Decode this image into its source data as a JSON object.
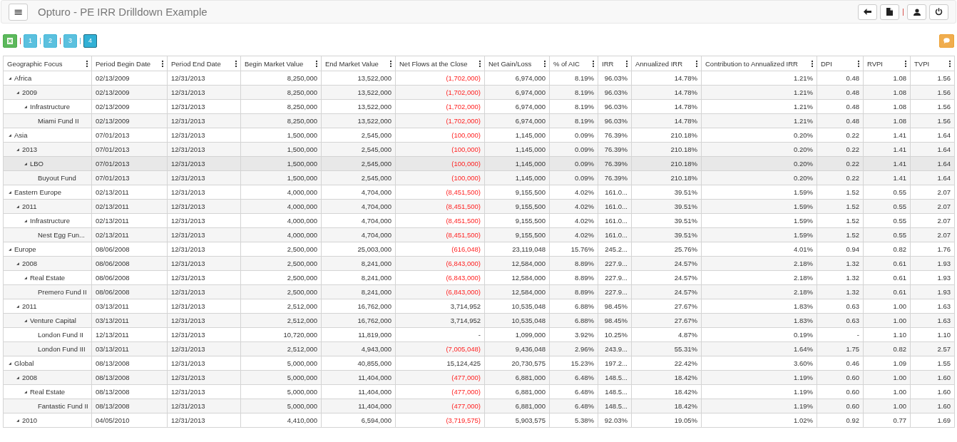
{
  "header": {
    "menu_icon": "≡",
    "title": "Opturo - PE IRR Drilldown Example"
  },
  "toolbar": {
    "levels": [
      {
        "label": "1",
        "selected": false
      },
      {
        "label": "2",
        "selected": false
      },
      {
        "label": "3",
        "selected": false
      },
      {
        "label": "4",
        "selected": true
      }
    ]
  },
  "table": {
    "tree_column": "Geographic Focus",
    "columns": [
      "Period Begin Date",
      "Period End Date",
      "Begin Market Value",
      "End Market Value",
      "Net Flows at the Close",
      "Net Gain/Loss",
      "% of AIC",
      "IRR",
      "Annualized IRR",
      "Contribution to Annualized IRR",
      "DPI",
      "RVPI",
      "TVPI"
    ],
    "rows": [
      {
        "label": "Africa",
        "expanded": true,
        "selected": false,
        "net_flows_negative": true,
        "cells": [
          "02/13/2009",
          "12/31/2013",
          "8,250,000",
          "13,522,000",
          "(1,702,000)",
          "6,974,000",
          "8.19%",
          "96.03%",
          "14.78%",
          "1.21%",
          "0.48",
          "1.08",
          "1.56"
        ],
        "children": [
          {
            "label": "2009",
            "expanded": true,
            "selected": false,
            "net_flows_negative": true,
            "cells": [
              "02/13/2009",
              "12/31/2013",
              "8,250,000",
              "13,522,000",
              "(1,702,000)",
              "6,974,000",
              "8.19%",
              "96.03%",
              "14.78%",
              "1.21%",
              "0.48",
              "1.08",
              "1.56"
            ],
            "children": [
              {
                "label": "Infrastructure",
                "expanded": true,
                "selected": false,
                "net_flows_negative": true,
                "cells": [
                  "02/13/2009",
                  "12/31/2013",
                  "8,250,000",
                  "13,522,000",
                  "(1,702,000)",
                  "6,974,000",
                  "8.19%",
                  "96.03%",
                  "14.78%",
                  "1.21%",
                  "0.48",
                  "1.08",
                  "1.56"
                ],
                "children": [
                  {
                    "label": "Miami Fund II",
                    "selected": false,
                    "net_flows_negative": true,
                    "cells": [
                      "02/13/2009",
                      "12/31/2013",
                      "8,250,000",
                      "13,522,000",
                      "(1,702,000)",
                      "6,974,000",
                      "8.19%",
                      "96.03%",
                      "14.78%",
                      "1.21%",
                      "0.48",
                      "1.08",
                      "1.56"
                    ]
                  }
                ]
              }
            ]
          }
        ]
      },
      {
        "label": "Asia",
        "expanded": true,
        "selected": false,
        "net_flows_negative": true,
        "cells": [
          "07/01/2013",
          "12/31/2013",
          "1,500,000",
          "2,545,000",
          "(100,000)",
          "1,145,000",
          "0.09%",
          "76.39%",
          "210.18%",
          "0.20%",
          "0.22",
          "1.41",
          "1.64"
        ],
        "children": [
          {
            "label": "2013",
            "expanded": true,
            "selected": false,
            "net_flows_negative": true,
            "cells": [
              "07/01/2013",
              "12/31/2013",
              "1,500,000",
              "2,545,000",
              "(100,000)",
              "1,145,000",
              "0.09%",
              "76.39%",
              "210.18%",
              "0.20%",
              "0.22",
              "1.41",
              "1.64"
            ],
            "children": [
              {
                "label": "LBO",
                "expanded": true,
                "selected": true,
                "net_flows_negative": true,
                "cells": [
                  "07/01/2013",
                  "12/31/2013",
                  "1,500,000",
                  "2,545,000",
                  "(100,000)",
                  "1,145,000",
                  "0.09%",
                  "76.39%",
                  "210.18%",
                  "0.20%",
                  "0.22",
                  "1.41",
                  "1.64"
                ],
                "children": [
                  {
                    "label": "Buyout Fund",
                    "selected": false,
                    "net_flows_negative": true,
                    "cells": [
                      "07/01/2013",
                      "12/31/2013",
                      "1,500,000",
                      "2,545,000",
                      "(100,000)",
                      "1,145,000",
                      "0.09%",
                      "76.39%",
                      "210.18%",
                      "0.20%",
                      "0.22",
                      "1.41",
                      "1.64"
                    ]
                  }
                ]
              }
            ]
          }
        ]
      },
      {
        "label": "Eastern Europe",
        "expanded": true,
        "selected": false,
        "net_flows_negative": true,
        "cells": [
          "02/13/2011",
          "12/31/2013",
          "4,000,000",
          "4,704,000",
          "(8,451,500)",
          "9,155,500",
          "4.02%",
          "161.0...",
          "39.51%",
          "1.59%",
          "1.52",
          "0.55",
          "2.07"
        ],
        "children": [
          {
            "label": "2011",
            "expanded": true,
            "selected": false,
            "net_flows_negative": true,
            "cells": [
              "02/13/2011",
              "12/31/2013",
              "4,000,000",
              "4,704,000",
              "(8,451,500)",
              "9,155,500",
              "4.02%",
              "161.0...",
              "39.51%",
              "1.59%",
              "1.52",
              "0.55",
              "2.07"
            ],
            "children": [
              {
                "label": "Infrastructure",
                "expanded": true,
                "selected": false,
                "net_flows_negative": true,
                "cells": [
                  "02/13/2011",
                  "12/31/2013",
                  "4,000,000",
                  "4,704,000",
                  "(8,451,500)",
                  "9,155,500",
                  "4.02%",
                  "161.0...",
                  "39.51%",
                  "1.59%",
                  "1.52",
                  "0.55",
                  "2.07"
                ],
                "children": [
                  {
                    "label": "Nest Egg Fun...",
                    "selected": false,
                    "net_flows_negative": true,
                    "cells": [
                      "02/13/2011",
                      "12/31/2013",
                      "4,000,000",
                      "4,704,000",
                      "(8,451,500)",
                      "9,155,500",
                      "4.02%",
                      "161.0...",
                      "39.51%",
                      "1.59%",
                      "1.52",
                      "0.55",
                      "2.07"
                    ]
                  }
                ]
              }
            ]
          }
        ]
      },
      {
        "label": "Europe",
        "expanded": true,
        "selected": false,
        "net_flows_negative": true,
        "cells": [
          "08/06/2008",
          "12/31/2013",
          "2,500,000",
          "25,003,000",
          "(616,048)",
          "23,119,048",
          "15.76%",
          "245.2...",
          "25.76%",
          "4.01%",
          "0.94",
          "0.82",
          "1.76"
        ],
        "children": [
          {
            "label": "2008",
            "expanded": true,
            "selected": false,
            "net_flows_negative": true,
            "cells": [
              "08/06/2008",
              "12/31/2013",
              "2,500,000",
              "8,241,000",
              "(6,843,000)",
              "12,584,000",
              "8.89%",
              "227.9...",
              "24.57%",
              "2.18%",
              "1.32",
              "0.61",
              "1.93"
            ],
            "children": [
              {
                "label": "Real Estate",
                "expanded": true,
                "selected": false,
                "net_flows_negative": true,
                "cells": [
                  "08/06/2008",
                  "12/31/2013",
                  "2,500,000",
                  "8,241,000",
                  "(6,843,000)",
                  "12,584,000",
                  "8.89%",
                  "227.9...",
                  "24.57%",
                  "2.18%",
                  "1.32",
                  "0.61",
                  "1.93"
                ],
                "children": [
                  {
                    "label": "Premero Fund II",
                    "selected": false,
                    "net_flows_negative": true,
                    "cells": [
                      "08/06/2008",
                      "12/31/2013",
                      "2,500,000",
                      "8,241,000",
                      "(6,843,000)",
                      "12,584,000",
                      "8.89%",
                      "227.9...",
                      "24.57%",
                      "2.18%",
                      "1.32",
                      "0.61",
                      "1.93"
                    ]
                  }
                ]
              }
            ]
          },
          {
            "label": "2011",
            "expanded": true,
            "selected": false,
            "net_flows_negative": false,
            "cells": [
              "03/13/2011",
              "12/31/2013",
              "2,512,000",
              "16,762,000",
              "3,714,952",
              "10,535,048",
              "6.88%",
              "98.45%",
              "27.67%",
              "1.83%",
              "0.63",
              "1.00",
              "1.63"
            ],
            "children": [
              {
                "label": "Venture Capital",
                "expanded": true,
                "selected": false,
                "net_flows_negative": false,
                "cells": [
                  "03/13/2011",
                  "12/31/2013",
                  "2,512,000",
                  "16,762,000",
                  "3,714,952",
                  "10,535,048",
                  "6.88%",
                  "98.45%",
                  "27.67%",
                  "1.83%",
                  "0.63",
                  "1.00",
                  "1.63"
                ],
                "children": [
                  {
                    "label": "London Fund II",
                    "selected": false,
                    "net_flows_negative": false,
                    "cells": [
                      "12/13/2011",
                      "12/31/2013",
                      "10,720,000",
                      "11,819,000",
                      "-",
                      "1,099,000",
                      "3.92%",
                      "10.25%",
                      "4.87%",
                      "0.19%",
                      "-",
                      "1.10",
                      "1.10"
                    ]
                  },
                  {
                    "label": "London Fund III",
                    "selected": false,
                    "net_flows_negative": true,
                    "cells": [
                      "03/13/2011",
                      "12/31/2013",
                      "2,512,000",
                      "4,943,000",
                      "(7,005,048)",
                      "9,436,048",
                      "2.96%",
                      "243.9...",
                      "55.31%",
                      "1.64%",
                      "1.75",
                      "0.82",
                      "2.57"
                    ]
                  }
                ]
              }
            ]
          }
        ]
      },
      {
        "label": "Global",
        "expanded": true,
        "selected": false,
        "net_flows_negative": false,
        "cells": [
          "08/13/2008",
          "12/31/2013",
          "5,000,000",
          "40,855,000",
          "15,124,425",
          "20,730,575",
          "15.23%",
          "197.2...",
          "22.42%",
          "3.60%",
          "0.46",
          "1.09",
          "1.55"
        ],
        "children": [
          {
            "label": "2008",
            "expanded": true,
            "selected": false,
            "net_flows_negative": true,
            "cells": [
              "08/13/2008",
              "12/31/2013",
              "5,000,000",
              "11,404,000",
              "(477,000)",
              "6,881,000",
              "6.48%",
              "148.5...",
              "18.42%",
              "1.19%",
              "0.60",
              "1.00",
              "1.60"
            ],
            "children": [
              {
                "label": "Real Estate",
                "expanded": true,
                "selected": false,
                "net_flows_negative": true,
                "cells": [
                  "08/13/2008",
                  "12/31/2013",
                  "5,000,000",
                  "11,404,000",
                  "(477,000)",
                  "6,881,000",
                  "6.48%",
                  "148.5...",
                  "18.42%",
                  "1.19%",
                  "0.60",
                  "1.00",
                  "1.60"
                ],
                "children": [
                  {
                    "label": "Fantastic Fund II",
                    "selected": false,
                    "net_flows_negative": true,
                    "cells": [
                      "08/13/2008",
                      "12/31/2013",
                      "5,000,000",
                      "11,404,000",
                      "(477,000)",
                      "6,881,000",
                      "6.48%",
                      "148.5...",
                      "18.42%",
                      "1.19%",
                      "0.60",
                      "1.00",
                      "1.60"
                    ]
                  }
                ]
              }
            ]
          },
          {
            "label": "2010",
            "expanded": true,
            "selected": false,
            "net_flows_negative": true,
            "cells": [
              "04/05/2010",
              "12/31/2013",
              "4,410,000",
              "6,594,000",
              "(3,719,575)",
              "5,903,575",
              "5.38%",
              "92.03%",
              "19.05%",
              "1.02%",
              "0.92",
              "0.77",
              "1.69"
            ]
          }
        ]
      }
    ]
  }
}
